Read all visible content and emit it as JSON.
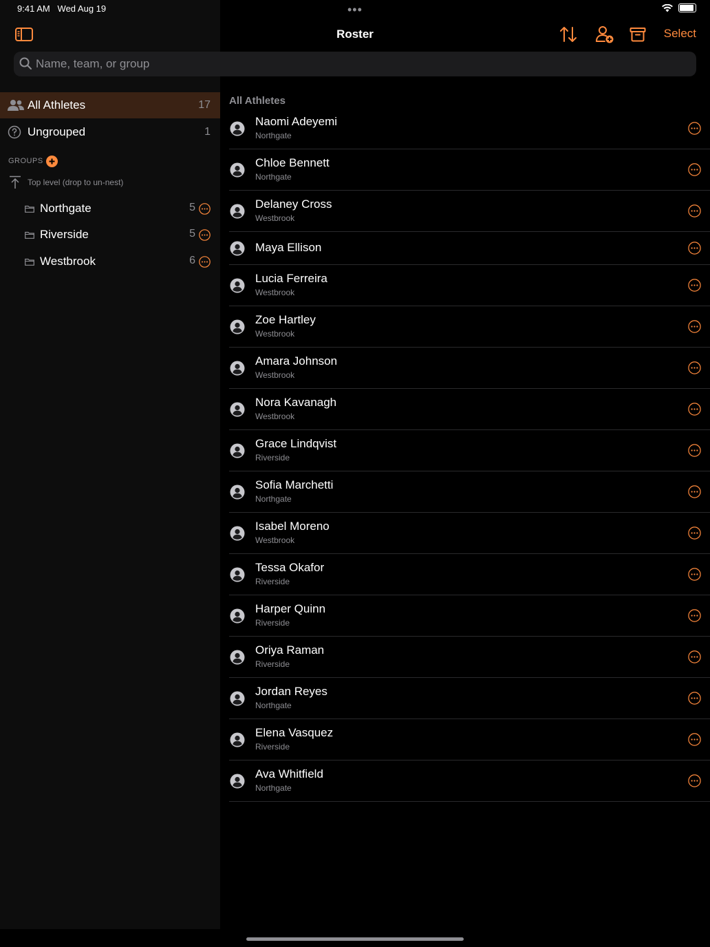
{
  "status": {
    "time": "9:41 AM",
    "date": "Wed Aug 19",
    "top_dots": "•••"
  },
  "nav": {
    "title": "Roster",
    "select_label": "Select"
  },
  "search": {
    "placeholder": "Name, team, or group"
  },
  "sidebar": {
    "all_athletes": {
      "label": "All Athletes",
      "count": "17"
    },
    "ungrouped": {
      "label": "Ungrouped",
      "count": "1"
    },
    "groups_header": "GROUPS",
    "top_level_label": "Top level (drop to un-nest)",
    "groups": [
      {
        "label": "Northgate",
        "count": "5"
      },
      {
        "label": "Riverside",
        "count": "5"
      },
      {
        "label": "Westbrook",
        "count": "6"
      }
    ]
  },
  "main": {
    "section_title": "All Athletes",
    "athletes": [
      {
        "name": "Naomi Adeyemi",
        "team": "Northgate"
      },
      {
        "name": "Chloe Bennett",
        "team": "Northgate"
      },
      {
        "name": "Delaney Cross",
        "team": "Westbrook"
      },
      {
        "name": "Maya Ellison",
        "team": ""
      },
      {
        "name": "Lucia Ferreira",
        "team": "Westbrook"
      },
      {
        "name": "Zoe Hartley",
        "team": "Westbrook"
      },
      {
        "name": "Amara Johnson",
        "team": "Westbrook"
      },
      {
        "name": "Nora Kavanagh",
        "team": "Westbrook"
      },
      {
        "name": "Grace Lindqvist",
        "team": "Riverside"
      },
      {
        "name": "Sofia Marchetti",
        "team": "Northgate"
      },
      {
        "name": "Isabel Moreno",
        "team": "Westbrook"
      },
      {
        "name": "Tessa Okafor",
        "team": "Riverside"
      },
      {
        "name": "Harper Quinn",
        "team": "Riverside"
      },
      {
        "name": "Oriya Raman",
        "team": "Riverside"
      },
      {
        "name": "Jordan Reyes",
        "team": "Northgate"
      },
      {
        "name": "Elena Vasquez",
        "team": "Riverside"
      },
      {
        "name": "Ava Whitfield",
        "team": "Northgate"
      }
    ]
  },
  "colors": {
    "accent": "#ff8a3d",
    "selected_row": "#3a2214",
    "secondary_text": "#8e8e93"
  }
}
